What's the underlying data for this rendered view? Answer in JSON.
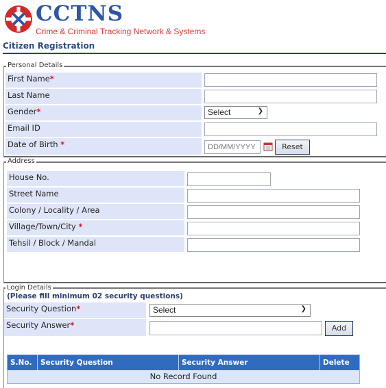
{
  "header": {
    "logo_title": "CCTNS",
    "logo_subtitle": "Crime & Criminal Tracking Network & Systems",
    "page_title": "Citizen Registration"
  },
  "personal": {
    "legend": "Personal Details",
    "first_name": "First Name",
    "last_name": "Last Name",
    "gender": "Gender",
    "gender_value": "Select",
    "email": "Email ID",
    "dob": "Date of Birth",
    "dob_placeholder": "DD/MM/YYYY",
    "reset": "Reset"
  },
  "address": {
    "legend": "Address",
    "house": "House No.",
    "street": "Street Name",
    "colony": "Colony / Locality / Area",
    "village": "Village/Town/City",
    "tehsil": "Tehsil / Block / Mandal"
  },
  "login": {
    "legend": "Login Details",
    "note": "(Please fill minimum 02 security questions)",
    "question": "Security Question",
    "question_value": "Select",
    "answer": "Security Answer",
    "add": "Add",
    "table": {
      "headers": [
        "S.No.",
        "Security Question",
        "Security Answer",
        "Delete"
      ],
      "empty": "No Record Found"
    }
  },
  "required_mark": "*",
  "colors": {
    "brand_blue": "#2d56a8",
    "brand_red": "#d63a3a",
    "table_header": "#2f6cc0",
    "label_bg": "#dfe5f8"
  }
}
